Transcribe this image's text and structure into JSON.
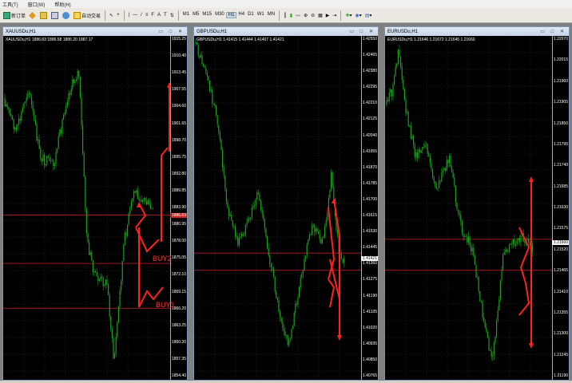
{
  "menu": [
    "工具(T)",
    "窗口(W)",
    "帮助(H)"
  ],
  "toolbar": {
    "new_order": "新订单",
    "auto_trading": "自动交易",
    "timeframes": [
      "M1",
      "M5",
      "M15",
      "M30",
      "H1",
      "H4",
      "D1",
      "W1",
      "MN"
    ],
    "active_timeframe": "H1"
  },
  "colors": {
    "candle": "#1f9e1f",
    "level_line": "#cc2222",
    "arrow": "#ff2020",
    "grid": "#3a3a3a"
  },
  "charts": [
    {
      "title": "XAUUSDu,H1",
      "info": "XAUUSDu,H1  1886.83 1886.58 1886.20 1887.17",
      "ticks": [
        "1915.25",
        "1910.40",
        "1913.45",
        "1907.55",
        "1904.60",
        "1901.65",
        "1898.70",
        "1895.75",
        "1892.80",
        "1889.85",
        "1883.90",
        "1880.95",
        "1878.00",
        "1875.05",
        "1872.10",
        "1869.15",
        "1866.20",
        "1863.25",
        "1860.30",
        "1857.35",
        "1854.40"
      ],
      "current_price": "1886.63",
      "labels": [
        "BUY2",
        "BUY1"
      ]
    },
    {
      "title": "GBPUSDu,H1",
      "info": "GBPUSDu,H1  1.41415 1.41444 1.41407 1.41421",
      "ticks": [
        "1.42550",
        "1.42465",
        "1.42380",
        "1.42295",
        "1.42210",
        "1.42125",
        "1.42040",
        "1.41955",
        "1.41870",
        "1.41785",
        "1.41700",
        "1.41615",
        "1.41530",
        "1.41445",
        "1.41360",
        "1.41275",
        "1.41190",
        "1.41105",
        "1.41020",
        "1.40935",
        "1.40850",
        "1.40765"
      ],
      "current_price": "1.41421"
    },
    {
      "title": "EURUSDu,H1",
      "info": "EURUSDu,H1  1.21646 1.21672 1.21645 1.21660",
      "ticks": [
        "1.22070",
        "1.22015",
        "1.21960",
        "1.21905",
        "1.21850",
        "1.21795",
        "1.21740",
        "1.21685",
        "1.21630",
        "1.21575",
        "1.21520",
        "1.21465",
        "1.21410",
        "1.21355",
        "1.21300",
        "1.21245",
        "1.21190"
      ],
      "current_price": "1.21660"
    }
  ]
}
